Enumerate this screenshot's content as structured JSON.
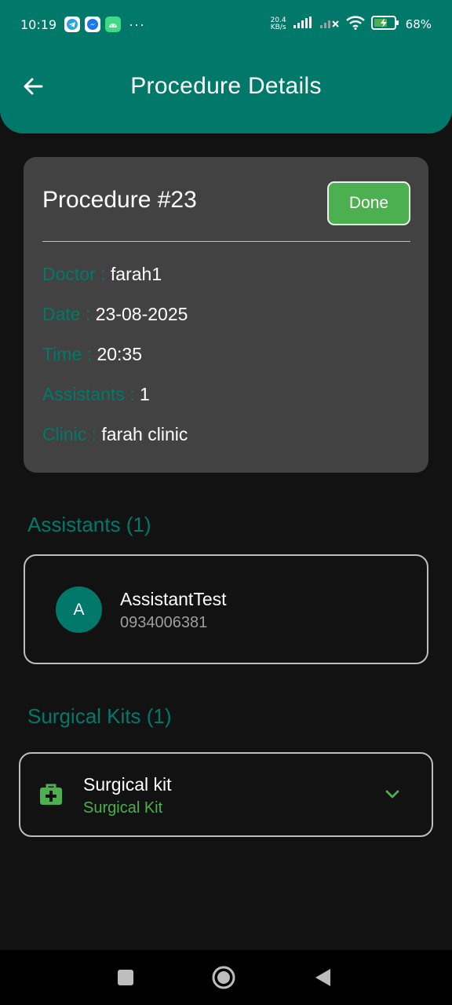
{
  "status_bar": {
    "time": "10:19",
    "net_speed_value": "20.4",
    "net_speed_unit": "KB/s",
    "battery_percent": "68%"
  },
  "app_bar": {
    "title": "Procedure Details",
    "back_icon": "arrow-left-icon"
  },
  "procedure": {
    "title": "Procedure #23",
    "status_button": "Done",
    "fields": [
      {
        "label": "Doctor : ",
        "value": "farah1"
      },
      {
        "label": "Date : ",
        "value": "23-08-2025"
      },
      {
        "label": "Time : ",
        "value": "20:35"
      },
      {
        "label": "Assistants : ",
        "value": "1"
      },
      {
        "label": "Clinic : ",
        "value": "farah clinic"
      }
    ]
  },
  "assistants_section": {
    "title": "Assistants (1)",
    "items": [
      {
        "initial": "A",
        "name": "AssistantTest",
        "phone": "0934006381"
      }
    ]
  },
  "kits_section": {
    "title": "Surgical Kits (1)",
    "items": [
      {
        "name": "Surgical kit",
        "type": "Surgical Kit",
        "icon": "medical-kit-icon",
        "expand_icon": "chevron-down-icon"
      }
    ]
  },
  "colors": {
    "primary": "#00796b",
    "accent_green": "#4caf50",
    "background": "#121212",
    "card": "#424242"
  }
}
